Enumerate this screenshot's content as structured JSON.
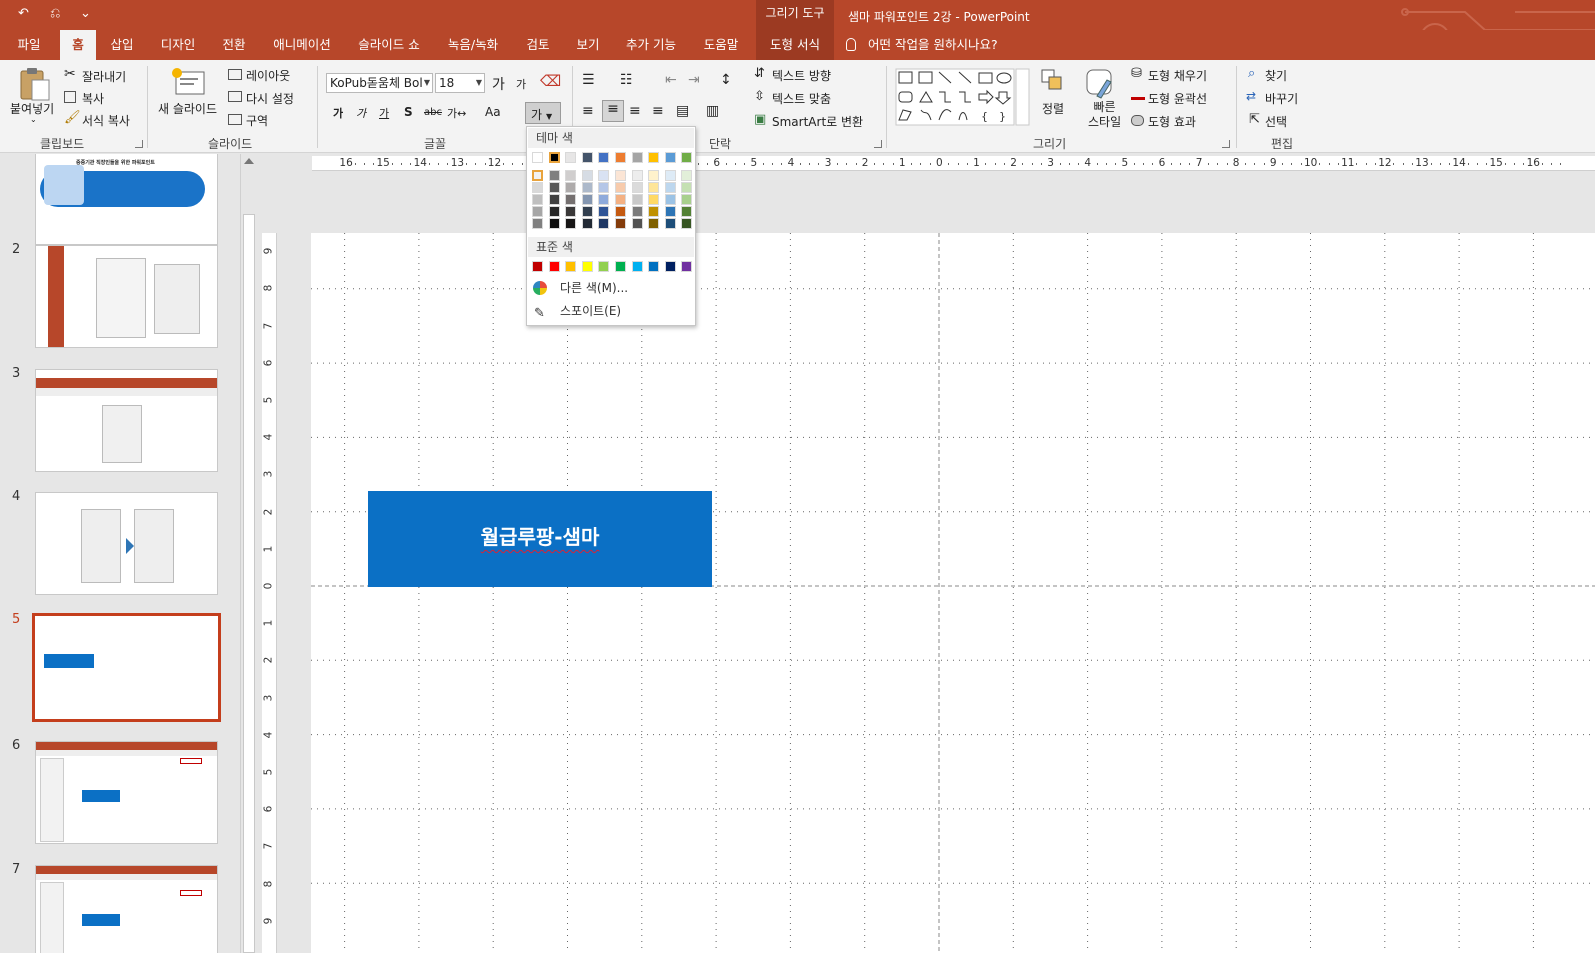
{
  "window": {
    "context_tool_label": "그리기 도구",
    "title": "샘마 파워포인트 2강  -  PowerPoint",
    "quick_access": [
      "↶",
      "⎌",
      "⌄"
    ]
  },
  "tabs": [
    {
      "label": "파일"
    },
    {
      "label": "홈"
    },
    {
      "label": "삽입"
    },
    {
      "label": "디자인"
    },
    {
      "label": "전환"
    },
    {
      "label": "애니메이션"
    },
    {
      "label": "슬라이드 쇼"
    },
    {
      "label": "녹음/녹화"
    },
    {
      "label": "검토"
    },
    {
      "label": "보기"
    },
    {
      "label": "추가 기능"
    },
    {
      "label": "도움말"
    },
    {
      "label": "도형 서식"
    }
  ],
  "tellme": "어떤 작업을 원하시나요?",
  "ribbon": {
    "clipboard": {
      "paste": "붙여넣기",
      "cut": "잘라내기",
      "copy": "복사",
      "format_painter": "서식 복사",
      "group": "클립보드"
    },
    "slides": {
      "new_slide": "새 슬라이드",
      "layout": "레이아웃",
      "reset": "다시 설정",
      "section": "구역",
      "group": "슬라이드"
    },
    "font": {
      "font_name": "KoPub돋움체 Bol",
      "font_size": "18",
      "grow": "가",
      "shrink": "가",
      "bold": "가",
      "italic": "가",
      "underline": "가",
      "shadow": "S",
      "strike": "abc",
      "spacing": "가↔",
      "case": "Aa",
      "color_button": "가",
      "group": "글꼴"
    },
    "paragraph": {
      "text_direction": "텍스트 방향",
      "align_text": "텍스트 맞춤",
      "smartart": "SmartArt로 변환",
      "group": "단락"
    },
    "drawing": {
      "arrange": "정렬",
      "quick_styles": "빠른 스타일",
      "quick_styles_l1": "빠른",
      "quick_styles_l2": "스타일",
      "fill": "도형 채우기",
      "outline": "도형 윤곽선",
      "effects": "도형 효과",
      "group": "그리기"
    },
    "editing": {
      "find": "찾기",
      "replace": "바꾸기",
      "select": "선택",
      "group": "편집"
    }
  },
  "color_dropdown": {
    "theme_header": "테마 색",
    "standard_header": "표준 색",
    "more_colors": "다른 색(M)...",
    "eyedropper": "스포이트(E)",
    "theme_top": [
      "#ffffff",
      "#000000",
      "#e7e6e6",
      "#44546a",
      "#4472c4",
      "#ed7d31",
      "#a5a5a5",
      "#ffc000",
      "#5b9bd5",
      "#70ad47"
    ],
    "theme_shades": [
      [
        "#f2f2f2",
        "#808080",
        "#d0cece",
        "#d6dce4",
        "#d9e2f3",
        "#fbe5d5",
        "#ededed",
        "#fff2cc",
        "#deebf6",
        "#e2efd9"
      ],
      [
        "#d9d9d9",
        "#595959",
        "#aeabab",
        "#adb9ca",
        "#b4c6e7",
        "#f7cbac",
        "#dbdbdb",
        "#fee599",
        "#bdd7ee",
        "#c5e0b3"
      ],
      [
        "#bfbfbf",
        "#404040",
        "#757070",
        "#8496b0",
        "#8eaadb",
        "#f4b183",
        "#c9c9c9",
        "#ffd965",
        "#9cc3e5",
        "#a8d08d"
      ],
      [
        "#a6a6a6",
        "#262626",
        "#3a3838",
        "#323f4f",
        "#2f5496",
        "#c55a11",
        "#7b7b7b",
        "#bf9000",
        "#2e75b5",
        "#538135"
      ],
      [
        "#808080",
        "#0d0d0d",
        "#171616",
        "#222a35",
        "#1f3864",
        "#833c0b",
        "#525252",
        "#7f6000",
        "#1e4e79",
        "#375623"
      ]
    ],
    "standard": [
      "#c00000",
      "#ff0000",
      "#ffc000",
      "#ffff00",
      "#92d050",
      "#00b050",
      "#00b0f0",
      "#0070c0",
      "#002060",
      "#7030a0"
    ]
  },
  "slides_panel": {
    "numbers": [
      "2",
      "3",
      "4",
      "5",
      "6",
      "7"
    ],
    "active": "5",
    "thumb1_title": "중증기관 직장인들을 위한 파워포인트"
  },
  "ruler": {
    "h_labels": [
      "16",
      "15",
      "14",
      "13",
      "12",
      "11",
      "10",
      "9",
      "8",
      "7",
      "6",
      "5",
      "4",
      "3",
      "2",
      "1",
      "0",
      "1",
      "2",
      "3",
      "4",
      "5",
      "6",
      "7",
      "8",
      "9",
      "10",
      "11",
      "12",
      "13",
      "14",
      "15",
      "16"
    ],
    "v_labels": [
      "9",
      "8",
      "7",
      "6",
      "5",
      "4",
      "3",
      "2",
      "1",
      "0",
      "1",
      "2",
      "3",
      "4",
      "5",
      "6",
      "7",
      "8",
      "9"
    ]
  },
  "slide": {
    "shape_text": "월급루팡-샘마",
    "shape_color": "#0b70c5"
  }
}
